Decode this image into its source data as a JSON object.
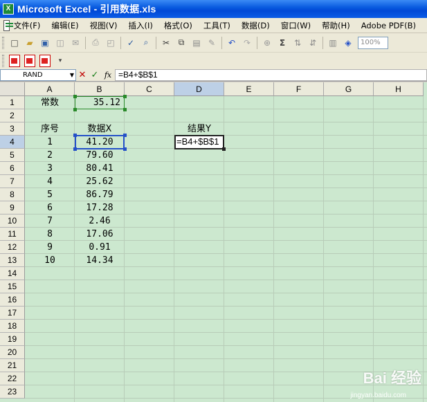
{
  "window": {
    "title": "Microsoft Excel - 引用数据.xls"
  },
  "menu": [
    "文件(F)",
    "编辑(E)",
    "视图(V)",
    "插入(I)",
    "格式(O)",
    "工具(T)",
    "数据(D)",
    "窗口(W)",
    "帮助(H)",
    "Adobe PDF(B)"
  ],
  "toolbar": {
    "zoom": "100%"
  },
  "formula_bar": {
    "name_box": "RAND",
    "cancel": "✕",
    "ok": "✓",
    "fx": "fx",
    "formula": "=B4+$B$1"
  },
  "sheet": {
    "columns": [
      "A",
      "B",
      "C",
      "D",
      "E",
      "F",
      "G",
      "H"
    ],
    "active_column": "D",
    "rows": [
      "1",
      "2",
      "3",
      "4",
      "5",
      "6",
      "7",
      "8",
      "9",
      "10",
      "11",
      "12",
      "13",
      "14",
      "15",
      "16",
      "17",
      "18",
      "19",
      "20",
      "21",
      "22",
      "23"
    ],
    "active_row": "4",
    "constant_label": "常数",
    "constant_value": "35.12",
    "header_index": "序号",
    "header_x": "数据X",
    "header_y": "结果Y",
    "editing_cell": "D4",
    "editing_text": "=B4+$B$1",
    "data_rows": [
      {
        "index": "1",
        "x": "41.20"
      },
      {
        "index": "2",
        "x": "79.60"
      },
      {
        "index": "3",
        "x": "80.41"
      },
      {
        "index": "4",
        "x": "25.62"
      },
      {
        "index": "5",
        "x": "86.79"
      },
      {
        "index": "6",
        "x": "17.28"
      },
      {
        "index": "7",
        "x": "2.46"
      },
      {
        "index": "8",
        "x": "17.06"
      },
      {
        "index": "9",
        "x": "0.91"
      },
      {
        "index": "10",
        "x": "14.34"
      }
    ]
  },
  "watermark": {
    "brand": "Bai 经验",
    "url": "jingyan.baidu.com"
  }
}
